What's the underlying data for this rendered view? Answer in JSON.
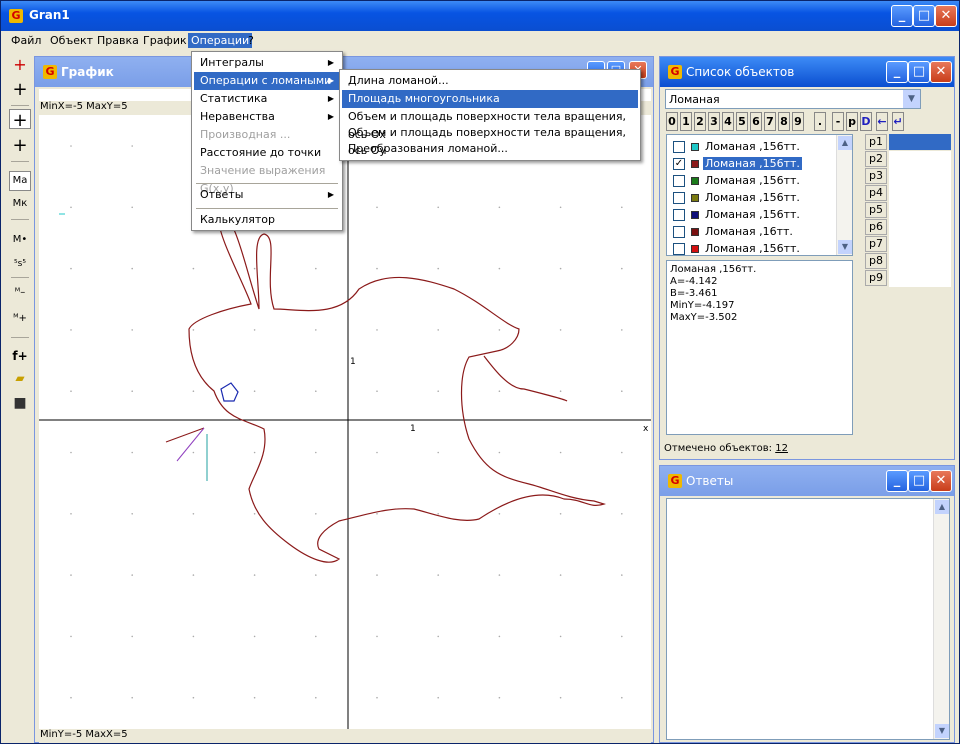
{
  "window": {
    "title": "Gran1"
  },
  "menubar": {
    "items": [
      "Файл",
      "Объект",
      "Правка",
      "График",
      "Операции",
      "?"
    ]
  },
  "left_toolbar": {
    "buttons": [
      "+",
      "+",
      "+",
      "+",
      "Ma",
      "Mк",
      "M•",
      "s",
      "M_",
      "M+",
      "f+",
      "open",
      "save"
    ]
  },
  "graph_window": {
    "title": "График",
    "top_range": "MinX=-5  MaxY=5",
    "bottom_range": "MinY=-5  MaxX=5",
    "x_axis_label": "x",
    "tick_x": "1",
    "tick_y": "1"
  },
  "operations_menu": {
    "items": [
      {
        "label": "Интегралы",
        "submenu": true,
        "disabled": false
      },
      {
        "label": "Операции с ломаными",
        "submenu": true,
        "disabled": false,
        "highlighted": true
      },
      {
        "label": "Статистика",
        "submenu": true,
        "disabled": false
      },
      {
        "label": "Неравенства",
        "submenu": true,
        "disabled": false
      },
      {
        "label": "Производная ...",
        "submenu": false,
        "disabled": true
      },
      {
        "label": "Расстояние до точки",
        "submenu": false,
        "disabled": false
      },
      {
        "label": "Значение выражения G(x,y)",
        "submenu": false,
        "disabled": true
      },
      {
        "label": "Ответы",
        "submenu": true,
        "disabled": false
      },
      {
        "label": "Калькулятор",
        "submenu": false,
        "disabled": false
      }
    ]
  },
  "polyline_submenu": {
    "items": [
      {
        "label": "Длина ломаной...",
        "highlighted": false
      },
      {
        "label": "Площадь многоугольника",
        "highlighted": true
      },
      {
        "label": "Объем и площадь поверхности тела вращения, ось Ох",
        "highlighted": false
      },
      {
        "label": "Объем и площадь поверхности тела вращения, ось Оу",
        "highlighted": false
      },
      {
        "label": "Преобразования ломаной...",
        "highlighted": false
      }
    ]
  },
  "objects_panel": {
    "title": "Список объектов",
    "combo_value": "Ломаная",
    "digit_buttons": [
      "0",
      "1",
      "2",
      "3",
      "4",
      "5",
      "6",
      "7",
      "8",
      "9",
      ".",
      "-",
      "p",
      "D",
      "←",
      "↵"
    ],
    "objects": [
      {
        "label": "Ломаная ,156тт.",
        "checked": false,
        "color": "#20c8c8",
        "selected": false
      },
      {
        "label": "Ломаная ,156тт.",
        "checked": true,
        "color": "#8b1a1a",
        "selected": true
      },
      {
        "label": "Ломаная ,156тт.",
        "checked": false,
        "color": "#1a7a1a",
        "selected": false
      },
      {
        "label": "Ломаная ,156тт.",
        "checked": false,
        "color": "#7a7a10",
        "selected": false
      },
      {
        "label": "Ломаная ,156тт.",
        "checked": false,
        "color": "#10107a",
        "selected": false
      },
      {
        "label": "Ломаная ,16тт.",
        "checked": false,
        "color": "#7a1010",
        "selected": false
      },
      {
        "label": "Ломаная ,156тт.",
        "checked": false,
        "color": "#d41010",
        "selected": false
      }
    ],
    "info_lines": [
      "Ломаная ,156тт.",
      "A=-4.142",
      "B=-3.461",
      "MinY=-4.197",
      "MaxY=-3.502"
    ],
    "p_buttons": [
      "p1",
      "p2",
      "p3",
      "p4",
      "p5",
      "p6",
      "p7",
      "p8",
      "p9"
    ],
    "status_label": "Отмечено объектов:",
    "status_value": "12"
  },
  "answers_panel": {
    "title": "Ответы"
  }
}
